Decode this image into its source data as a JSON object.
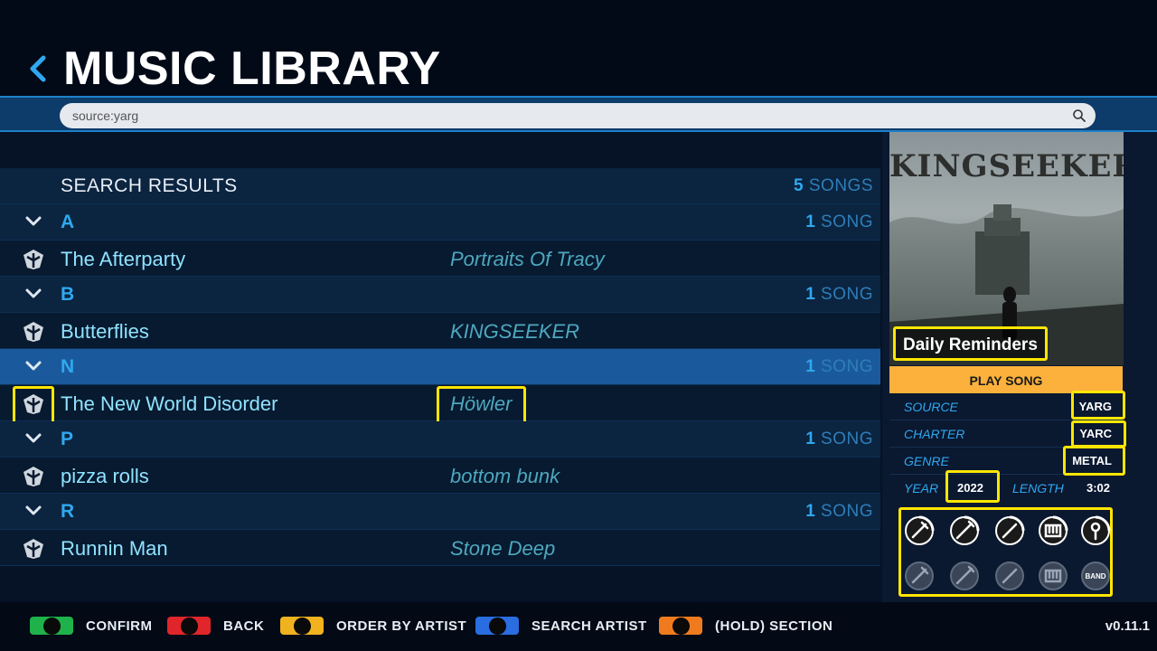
{
  "header": {
    "title": "MUSIC LIBRARY"
  },
  "search": {
    "value": "source:yarg"
  },
  "results": {
    "title": "SEARCH RESULTS",
    "count_num": "5",
    "count_label": " SONGS"
  },
  "groups": [
    {
      "letter": "A",
      "count_num": "1",
      "count_label": " SONG",
      "song": {
        "title": "The Afterparty",
        "artist": "Portraits Of Tracy"
      }
    },
    {
      "letter": "B",
      "count_num": "1",
      "count_label": " SONG",
      "song": {
        "title": "Butterflies",
        "artist": "KINGSEEKER"
      }
    },
    {
      "letter": "N",
      "count_num": "1",
      "count_label": " SONG",
      "song": {
        "title": "The New World Disorder",
        "artist": "Höwler"
      }
    },
    {
      "letter": "P",
      "count_num": "1",
      "count_label": " SONG",
      "song": {
        "title": "pizza rolls",
        "artist": "bottom bunk"
      }
    },
    {
      "letter": "R",
      "count_num": "1",
      "count_label": " SONG",
      "song": {
        "title": "Runnin Man",
        "artist": "Stone Deep"
      }
    }
  ],
  "selected_group": "N",
  "sidebar": {
    "album_art_text": "KINGSEEKER",
    "song_name": "Daily Reminders",
    "play_label": "PLAY SONG",
    "source_label": "SOURCE",
    "source_value": "YARG",
    "charter_label": "CHARTER",
    "charter_value": "YARC",
    "genre_label": "GENRE",
    "genre_value": "METAL",
    "year_label": "YEAR",
    "year_value": "2022",
    "length_label": "LENGTH",
    "length_value": "3:02",
    "instruments_top": [
      "guitar-icon",
      "bass-icon",
      "drums-icon",
      "keys-icon",
      "vocals-icon"
    ],
    "instruments_bottom": [
      "pro-guitar-icon",
      "pro-bass-icon",
      "pro-drums-icon",
      "pro-keys-icon",
      "band-icon"
    ],
    "band_label": "BAND"
  },
  "footer": {
    "buttons": [
      {
        "label": "CONFIRM",
        "color": "#1fb24a"
      },
      {
        "label": "BACK",
        "color": "#e0262b"
      },
      {
        "label": "ORDER BY ARTIST",
        "color": "#f0b21e"
      },
      {
        "label": "SEARCH ARTIST",
        "color": "#2a6de0"
      },
      {
        "label": "(HOLD) SECTION",
        "color": "#f07b1e"
      }
    ],
    "version": "v0.11.1"
  }
}
